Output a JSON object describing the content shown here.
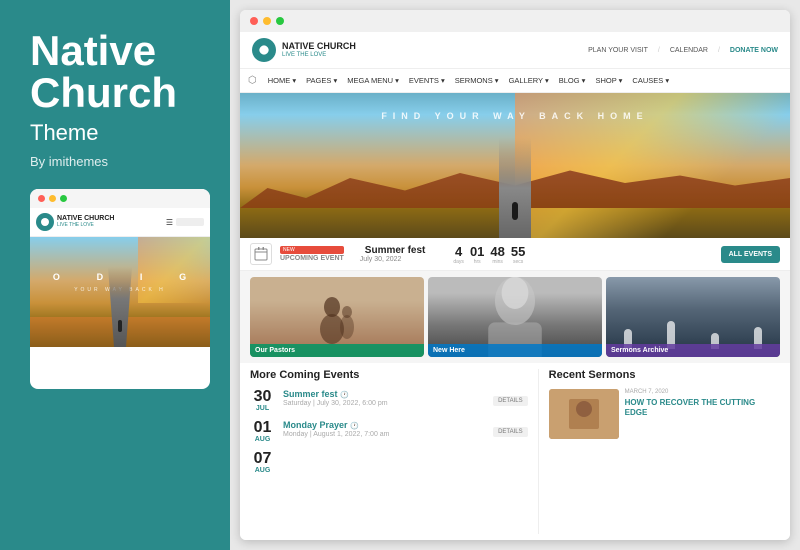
{
  "left": {
    "title_line1": "Native",
    "title_line2": "Church",
    "subtitle": "Theme",
    "by": "By imithemes"
  },
  "mobile_preview": {
    "logo_text": "NATIVE CHURCH",
    "logo_subtext": "LIVE THE LOVE",
    "hero_text1": "O D I G",
    "hero_text2": "YOUR WAY BACK H"
  },
  "desktop": {
    "dots": [
      "red",
      "yellow",
      "green"
    ],
    "header": {
      "logo": "NATIVE CHURCH",
      "logo_sub": "LIVE THE LOVE",
      "links": [
        "PLAN YOUR VISIT",
        "CALENDAR",
        "DONATE NOW"
      ]
    },
    "nav": [
      "HOME",
      "PAGES",
      "MEGA MENU",
      "EVENTS",
      "SERMONS",
      "GALLERY",
      "BLOG",
      "SHOP",
      "CAUSES"
    ],
    "hero_text": "FIND YOUR WAY BACK HOME",
    "events_bar": {
      "new_label": "NEW",
      "upcoming_label": "UPCOMING EVENT",
      "event_name": "Summer fest",
      "event_date": "July 30, 2022",
      "countdown": {
        "days": "4",
        "hrs": "01",
        "mins": "48",
        "secs": "55"
      },
      "all_events_btn": "ALL EVENTS"
    },
    "cards": [
      {
        "label": "Our Pastors"
      },
      {
        "label": "New Here"
      },
      {
        "label": "Sermons Archive"
      }
    ],
    "more_events_title": "More Coming Events",
    "events": [
      {
        "day": "30",
        "month": "JUL",
        "title": "Summer fest",
        "meta": "Saturday | July 30, 2022, 6:00 pm",
        "details": "DETAILS"
      },
      {
        "day": "01",
        "month": "AUG",
        "title": "Monday Prayer",
        "meta": "Monday | August 1, 2022, 7:00 am",
        "details": "DETAILS"
      },
      {
        "day": "07",
        "month": "AUG",
        "title": "",
        "meta": "",
        "details": ""
      }
    ],
    "sermons_title": "Recent Sermons",
    "sermon": {
      "date": "MARCH 7, 2020",
      "title": "HOW TO RECOVER THE CUTTING EDGE"
    }
  }
}
